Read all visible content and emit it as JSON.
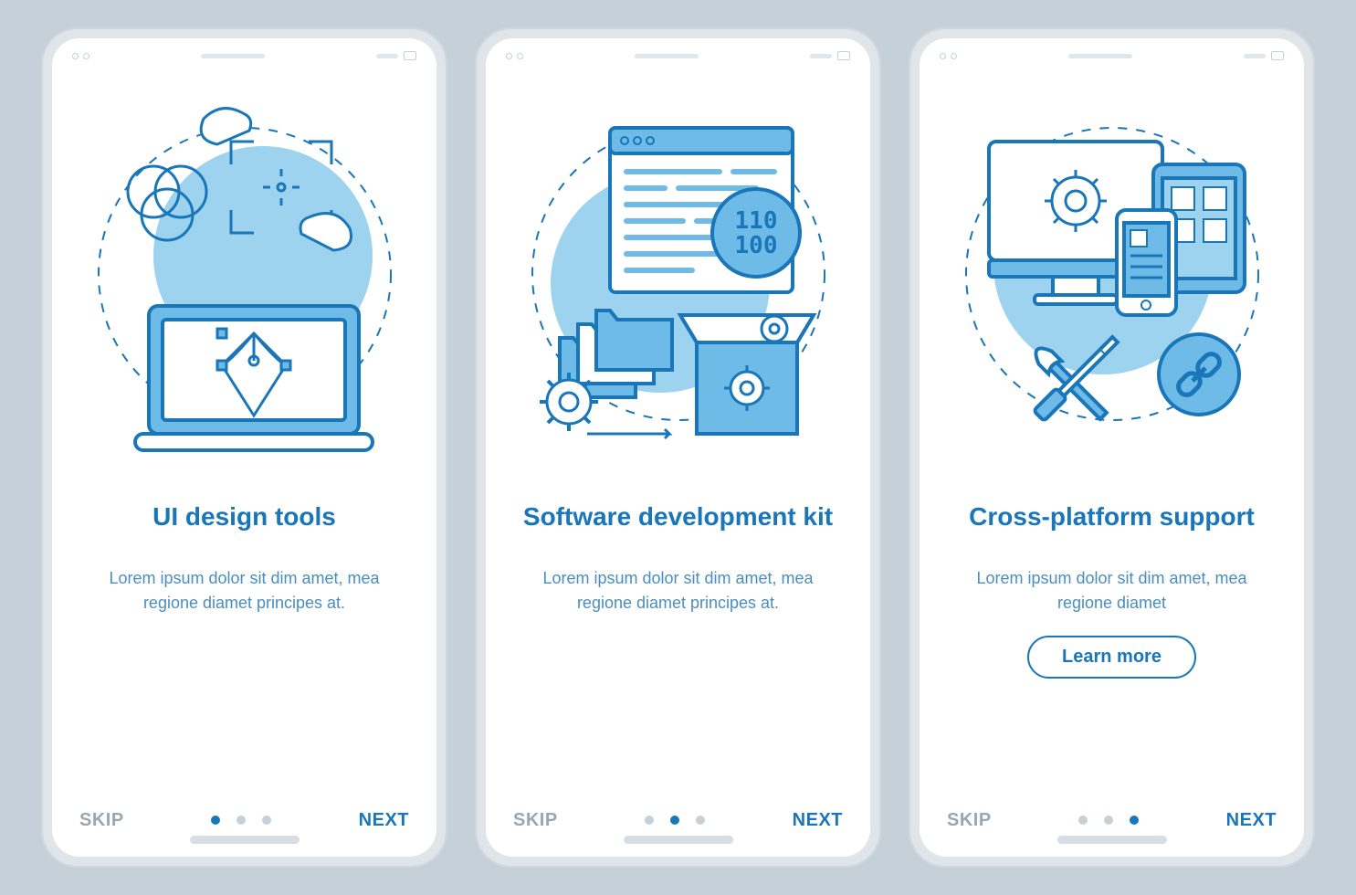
{
  "colors": {
    "primary": "#1976b8",
    "light": "#6ebbe8",
    "bg_circle": "#9dd3ef"
  },
  "screens": [
    {
      "title": "UI design tools",
      "desc": "Lorem ipsum dolor sit dim amet, mea regione diamet principes at.",
      "skip": "SKIP",
      "next": "NEXT",
      "active_dot": 0,
      "has_cta": false,
      "illustration": "ui-design"
    },
    {
      "title": "Software development kit",
      "desc": "Lorem ipsum dolor sit dim amet, mea regione diamet principes at.",
      "skip": "SKIP",
      "next": "NEXT",
      "active_dot": 1,
      "has_cta": false,
      "illustration": "sdk"
    },
    {
      "title": "Cross-platform support",
      "desc": "Lorem ipsum dolor sit dim amet, mea regione diamet",
      "skip": "SKIP",
      "next": "NEXT",
      "active_dot": 2,
      "has_cta": true,
      "cta": "Learn more",
      "illustration": "cross-platform"
    }
  ]
}
